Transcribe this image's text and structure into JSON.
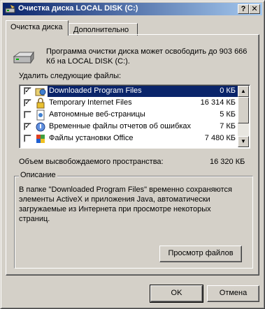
{
  "window": {
    "title": "Очистка диска LOCAL DISK (C:)",
    "help_label": "?",
    "close_label": "✕"
  },
  "tabs": [
    {
      "label": "Очистка диска",
      "active": true
    },
    {
      "label": "Дополнительно",
      "active": false
    }
  ],
  "info": {
    "text": "Программа очистки диска может освободить до 903 666 Кб на LOCAL DISK (C:)."
  },
  "files_label": "Удалить следующие файлы:",
  "files": [
    {
      "name": "Downloaded Program Files",
      "size": "0 КБ",
      "checked": true,
      "selected": true,
      "icon": "folder-globe-icon"
    },
    {
      "name": "Temporary Internet Files",
      "size": "16 314 КБ",
      "checked": true,
      "selected": false,
      "icon": "lock-icon"
    },
    {
      "name": "Автономные веб-страницы",
      "size": "5 КБ",
      "checked": false,
      "selected": false,
      "icon": "page-icon"
    },
    {
      "name": "Временные файлы отчетов об ошибках",
      "size": "7 КБ",
      "checked": true,
      "selected": false,
      "icon": "report-icon"
    },
    {
      "name": "Файлы установки Office",
      "size": "7 480 КБ",
      "checked": false,
      "selected": false,
      "icon": "office-icon"
    }
  ],
  "space": {
    "label": "Объем высвобождаемого пространства:",
    "value": "16 320 КБ"
  },
  "description": {
    "title": "Описание",
    "text": "В папке \"Downloaded Program Files\" временно сохраняются элементы ActiveX и приложения Java, автоматически загружаемые из Интернета при просмотре некоторых страниц.",
    "view_button": "Просмотр файлов"
  },
  "buttons": {
    "ok": "OK",
    "cancel": "Отмена"
  },
  "colors": {
    "title_start": "#0a246a",
    "title_end": "#a6caf0",
    "face": "#d4d0c8",
    "selection": "#0a246a"
  }
}
